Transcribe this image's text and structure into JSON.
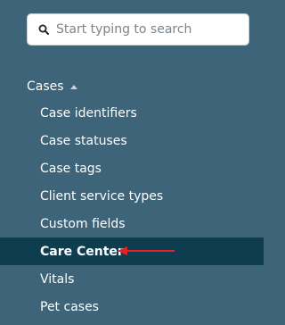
{
  "search": {
    "placeholder": "Start typing to search"
  },
  "section": {
    "label": "Cases"
  },
  "menu": {
    "items": [
      {
        "label": "Case identifiers"
      },
      {
        "label": "Case statuses"
      },
      {
        "label": "Case tags"
      },
      {
        "label": "Client service types"
      },
      {
        "label": "Custom fields"
      },
      {
        "label": "Care Center",
        "active": true
      },
      {
        "label": "Vitals"
      },
      {
        "label": "Pet cases"
      }
    ]
  },
  "colors": {
    "sidebar_background": "#3d6478",
    "active_item_background": "#0e3d4f",
    "annotation_arrow": "#e02424"
  },
  "icons": {
    "search": "search-icon",
    "caret": "caret-up-icon",
    "annotation": "red-arrow-icon"
  }
}
